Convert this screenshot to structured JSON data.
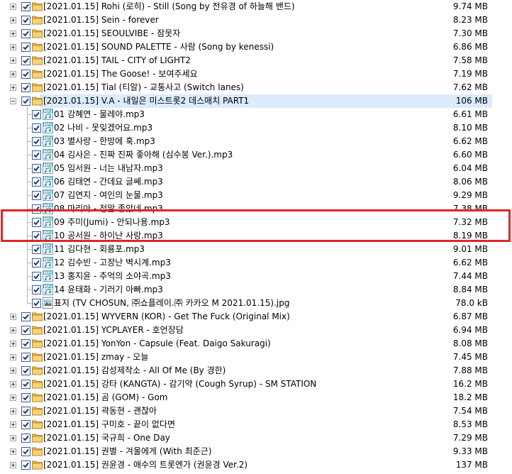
{
  "rows": [
    {
      "type": "folder",
      "name": "[2021.01.15] Rohi (로히) - Still (Song by 전유경 of 하늘해 밴드)",
      "size": "9.74 MB"
    },
    {
      "type": "folder",
      "name": "[2021.01.15] Sein - forever",
      "size": "8.23 MB"
    },
    {
      "type": "folder",
      "name": "[2021.01.15] SEOULVIBE - 잠못자",
      "size": "7.30 MB"
    },
    {
      "type": "folder",
      "name": "[2021.01.15] SOUND PALETTE - 사람 (Song by kenessi)",
      "size": "6.86 MB"
    },
    {
      "type": "folder",
      "name": "[2021.01.15] TAIL - CITY of LIGHT2",
      "size": "7.58 MB"
    },
    {
      "type": "folder",
      "name": "[2021.01.15] The Goose! - 보여주세요",
      "size": "7.19 MB"
    },
    {
      "type": "folder",
      "name": "[2021.01.15] Tial (티알) - 교통사고 (Switch lanes)",
      "size": "7.62 MB"
    },
    {
      "type": "folder",
      "expanded": true,
      "selected": true,
      "name": "[2021.01.15] V.A - 내일은 미스트롯2 데스매치 PART1",
      "size": "106 MB"
    },
    {
      "type": "mp3",
      "name": "01 강혜연 - 물레야.mp3",
      "size": "6.61 MB"
    },
    {
      "type": "mp3",
      "name": "02 나비 - 못잊겠어요.mp3",
      "size": "8.10 MB"
    },
    {
      "type": "mp3",
      "name": "03 별사랑 - 한방에 훅.mp3",
      "size": "6.62 MB"
    },
    {
      "type": "mp3",
      "name": "04 김사은 - 진짜 진짜 좋아해 (심수봉 Ver.).mp3",
      "size": "6.60 MB"
    },
    {
      "type": "mp3",
      "name": "05 임서원 - 너는 내남자.mp3",
      "size": "6.04 MB"
    },
    {
      "type": "mp3",
      "name": "06 김태연 - 간데요 글쎄.mp3",
      "size": "8.06 MB"
    },
    {
      "type": "mp3",
      "name": "07 김연지 - 여인의 눈물.mp3",
      "size": "9.29 MB"
    },
    {
      "type": "mp3",
      "name": "08 마리아 - 정말 좋았네.mp3",
      "size": "7.38 MB"
    },
    {
      "type": "mp3",
      "name": "09 주미(Jumi) - 안되나용.mp3",
      "size": "7.32 MB"
    },
    {
      "type": "mp3",
      "name": "10 공서원 - 하이난 사랑.mp3",
      "size": "8.19 MB"
    },
    {
      "type": "mp3",
      "name": "11 김다현 - 회룡포.mp3",
      "size": "9.01 MB"
    },
    {
      "type": "mp3",
      "name": "12 김수빈 - 고장난 벽시계.mp3",
      "size": "6.62 MB"
    },
    {
      "type": "mp3",
      "name": "13 홍지윤 - 추억의 소야곡.mp3",
      "size": "7.44 MB"
    },
    {
      "type": "mp3",
      "name": "14 윤태화 - 기러기 아빠.mp3",
      "size": "8.84 MB"
    },
    {
      "type": "jpg",
      "name": "표지 (TV CHOSUN, ㈜쇼플레이.㈜ 카카오 M 2021.01.15).jpg",
      "size": "78.0 kB"
    },
    {
      "type": "folder",
      "name": "[2021.01.15] WYVERN (KOR) - Get The Fuck (Original Mix)",
      "size": "6.87 MB"
    },
    {
      "type": "folder",
      "name": "[2021.01.15] YCPLAYER - 호언장담",
      "size": "6.94 MB"
    },
    {
      "type": "folder",
      "name": "[2021.01.15] YonYon - Capsule (Feat. Daigo Sakuragi)",
      "size": "8.08 MB"
    },
    {
      "type": "folder",
      "name": "[2021.01.15] zmay - 오늘",
      "size": "7.45 MB"
    },
    {
      "type": "folder",
      "name": "[2021.01.15] 감성제작소 - All Of Me (By 경한)",
      "size": "7.88 MB"
    },
    {
      "type": "folder",
      "name": "[2021.01.15] 강타 (KANGTA) - 감기약 (Cough Syrup) - SM STATION",
      "size": "16.2 MB"
    },
    {
      "type": "folder",
      "name": "[2021.01.15] 곰 (GOM) - Gom",
      "size": "18.2 MB"
    },
    {
      "type": "folder",
      "name": "[2021.01.15] 곽동현 - 괜찮아",
      "size": "7.54 MB"
    },
    {
      "type": "folder",
      "name": "[2021.01.15] 구미호 - 끝이 없다면",
      "size": "8.53 MB"
    },
    {
      "type": "folder",
      "name": "[2021.01.15] 국규희 - One Day",
      "size": "7.29 MB"
    },
    {
      "type": "folder",
      "name": "[2021.01.15] 권별 - 겨울에게 (With 최준근)",
      "size": "9.33 MB"
    },
    {
      "type": "folder",
      "name": "[2021.01.15] 권윤경 - 애수의 트롯엔가 (권윤경 Ver.2)",
      "size": "137 MB"
    }
  ],
  "icons": {
    "folder": "folder-icon",
    "mp3": "mp3-file-icon",
    "jpg": "image-file-icon"
  },
  "colors": {
    "highlight_border": "#e0262a",
    "selected_row": "#dcebfc",
    "checkbox_border": "#3d5e96",
    "checkmark": "#1d2f5c"
  }
}
